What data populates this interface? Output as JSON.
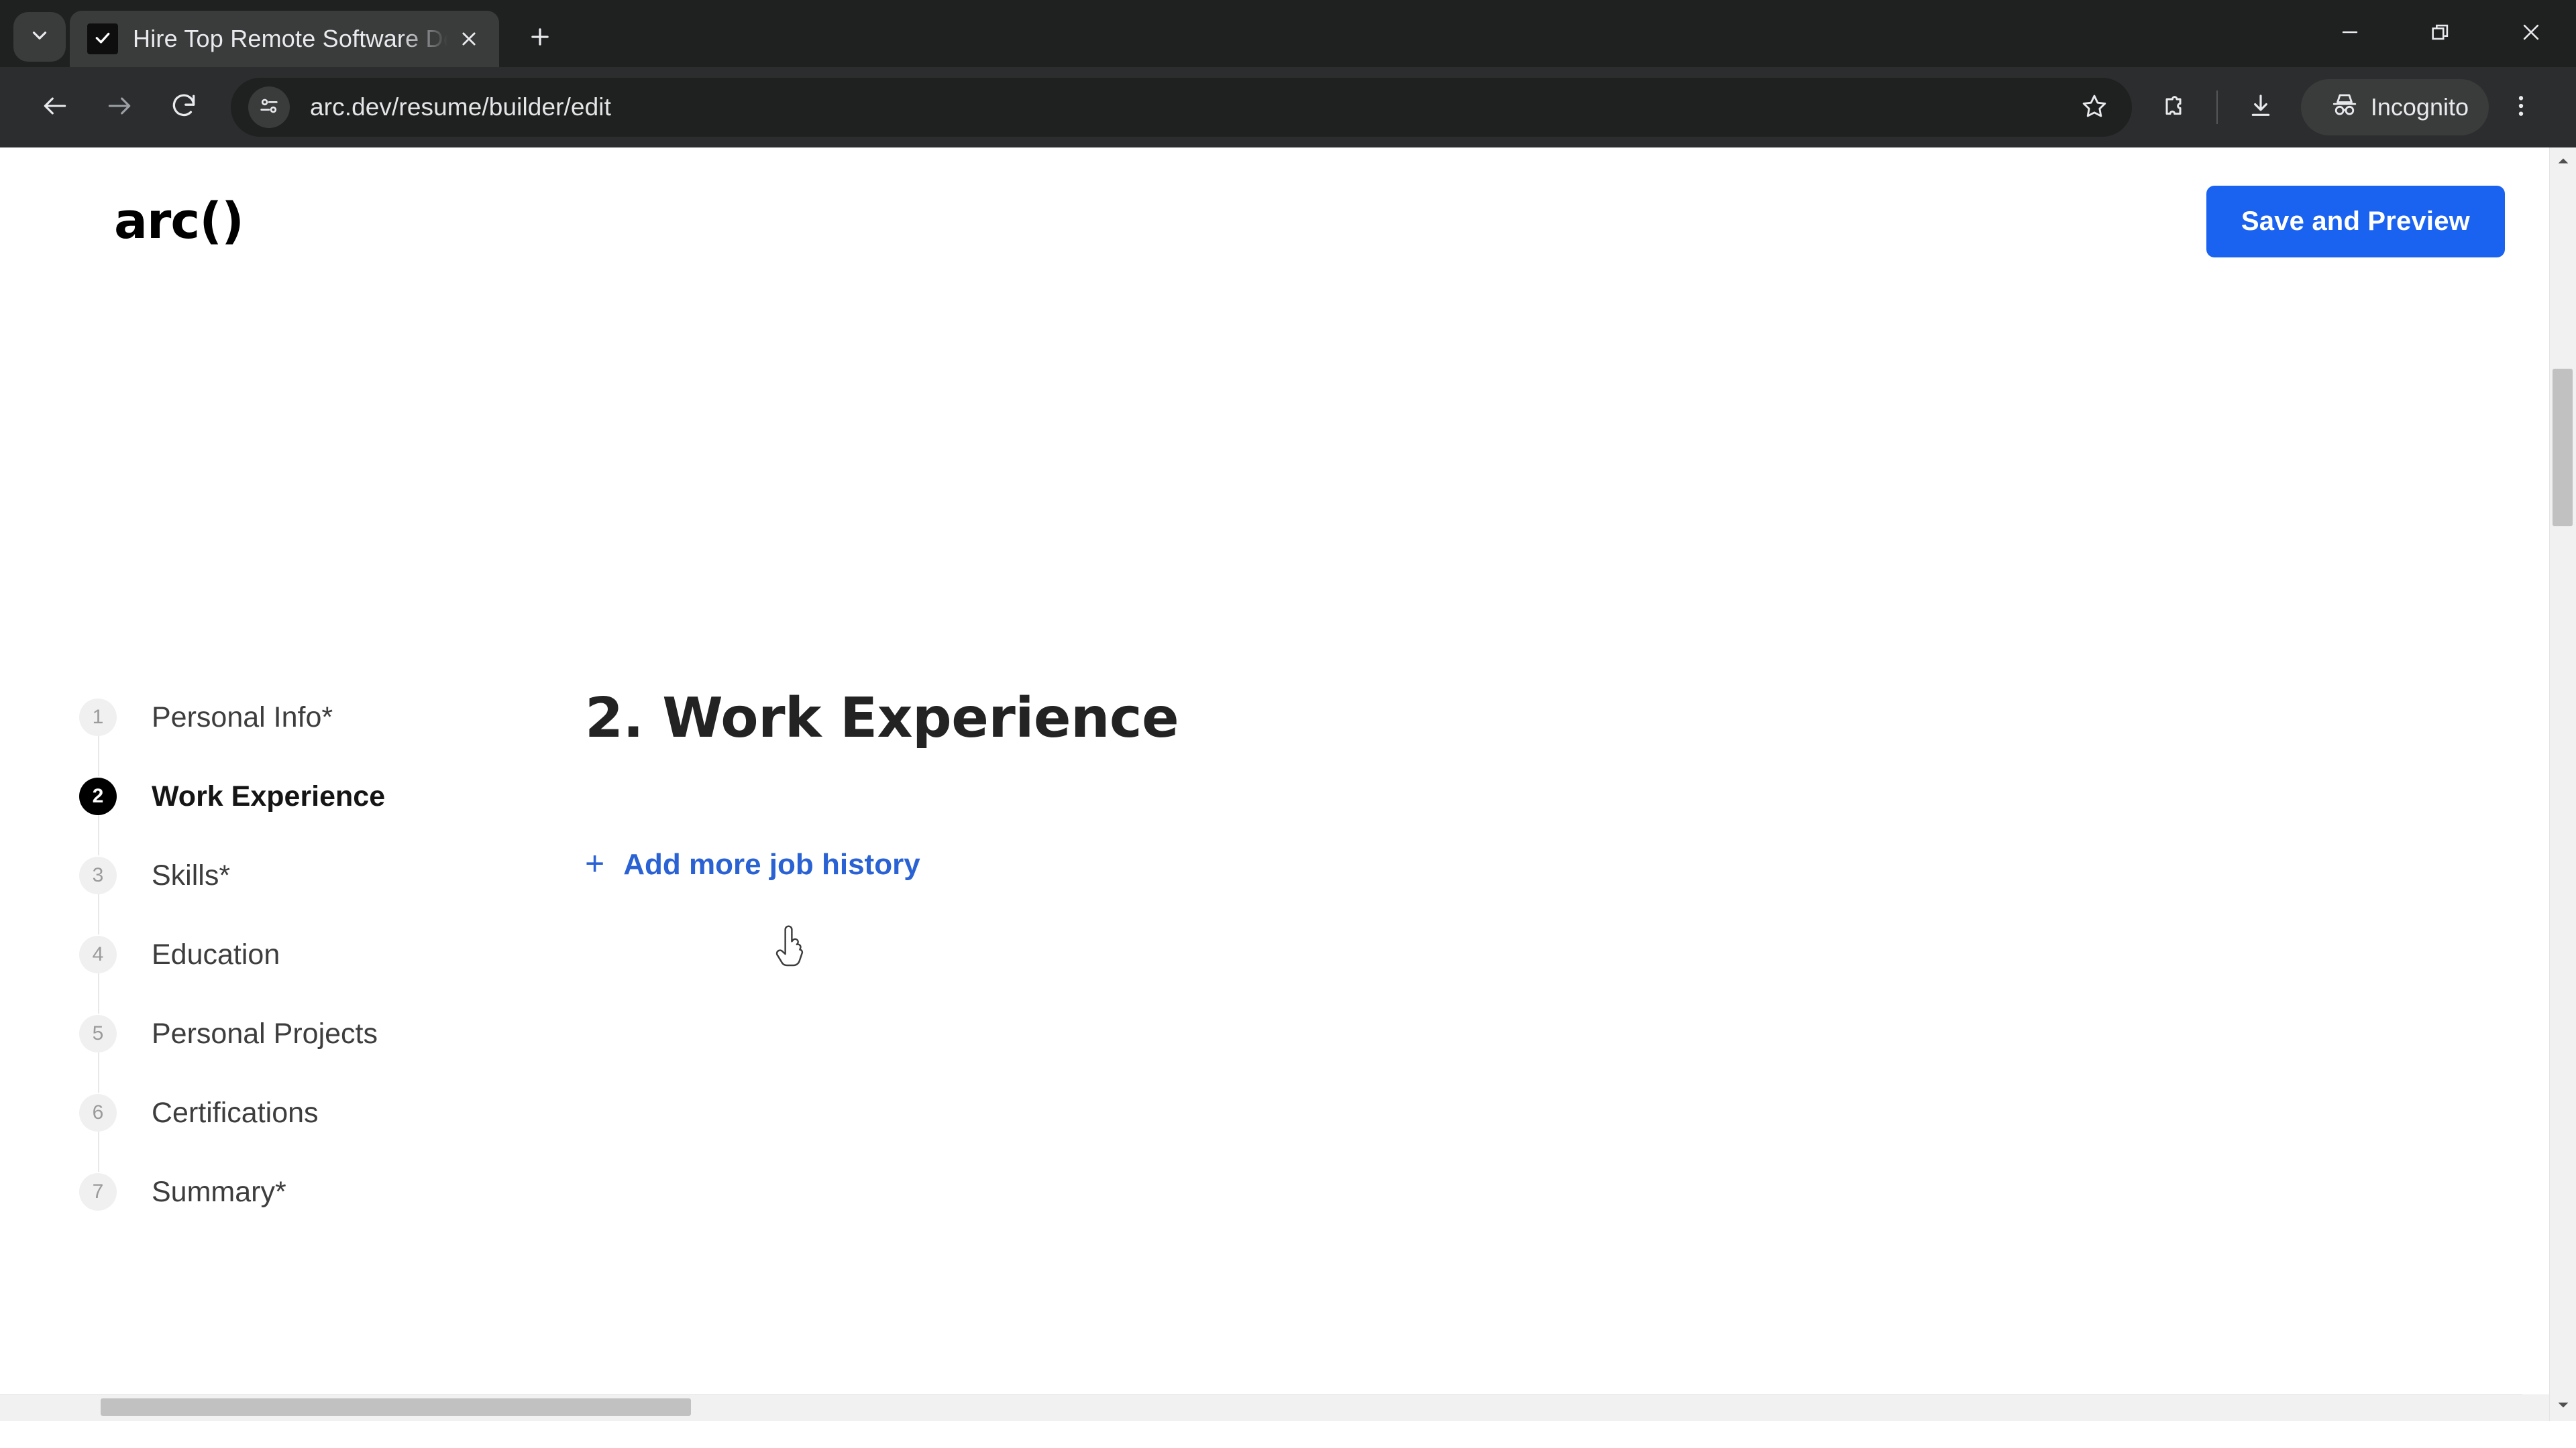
{
  "browser": {
    "tab_search_icon": "chevron-down-icon",
    "tab": {
      "favicon": "arc-favicon",
      "title": "Hire Top Remote Software Deve",
      "close_icon": "close-icon"
    },
    "new_tab_icon": "plus-icon",
    "window_controls": {
      "minimize_icon": "minimize-icon",
      "restore_icon": "restore-icon",
      "close_icon": "close-icon"
    },
    "toolbar": {
      "back_icon": "back-arrow-icon",
      "forward_icon": "forward-arrow-icon",
      "reload_icon": "reload-icon",
      "site_info_icon": "tune-icon",
      "url": "arc.dev/resume/builder/edit",
      "bookmark_icon": "star-icon",
      "extensions_icon": "extensions-icon",
      "downloads_icon": "download-icon",
      "profile_label": "Incognito",
      "profile_icon": "incognito-icon",
      "menu_icon": "kebab-menu-icon"
    }
  },
  "page": {
    "header": {
      "brand": "arc()",
      "save_button": "Save and Preview"
    },
    "stepper": {
      "steps": [
        {
          "number": "1",
          "label": "Personal Info*",
          "active": false
        },
        {
          "number": "2",
          "label": "Work Experience",
          "active": true
        },
        {
          "number": "3",
          "label": "Skills*",
          "active": false
        },
        {
          "number": "4",
          "label": "Education",
          "active": false
        },
        {
          "number": "5",
          "label": "Personal Projects",
          "active": false
        },
        {
          "number": "6",
          "label": "Certifications",
          "active": false
        },
        {
          "number": "7",
          "label": "Summary*",
          "active": false
        }
      ]
    },
    "main": {
      "section_title": "2. Work Experience",
      "add_job_plus": "+",
      "add_job_label": "Add more job history"
    },
    "scrollbars": {
      "vertical_up_icon": "caret-up-icon",
      "vertical_down_icon": "caret-down-icon"
    }
  },
  "colors": {
    "accent_blue": "#1a62f0",
    "link_blue": "#2a62d4",
    "active_step": "#000000",
    "chrome_bg": "#1f2020",
    "toolbar_bg": "#2c2d2e"
  }
}
